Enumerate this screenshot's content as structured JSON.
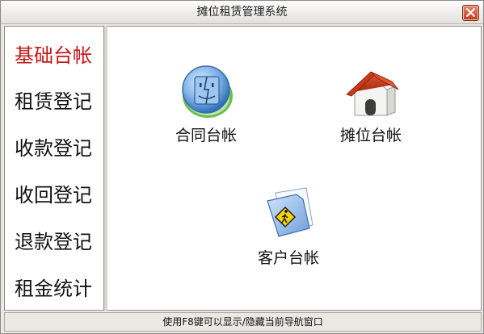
{
  "window": {
    "title": "摊位租赁管理系统"
  },
  "sidebar": {
    "items": [
      {
        "label": "基础台帐",
        "active": true
      },
      {
        "label": "租赁登记"
      },
      {
        "label": "收款登记"
      },
      {
        "label": "收回登记"
      },
      {
        "label": "退款登记"
      },
      {
        "label": "租金统计"
      }
    ]
  },
  "main": {
    "tiles": [
      {
        "label": "合同台帐",
        "icon": "finder-face-icon"
      },
      {
        "label": "摊位台帐",
        "icon": "house-icon"
      },
      {
        "label": "客户台帐",
        "icon": "folder-pedestrian-icon"
      }
    ]
  },
  "statusbar": {
    "text": "使用F8键可以显示/隐藏当前导航窗口"
  },
  "colors": {
    "active_nav": "#c41616",
    "window_bg": "#ece9e4",
    "close_button": "#c2391a"
  }
}
